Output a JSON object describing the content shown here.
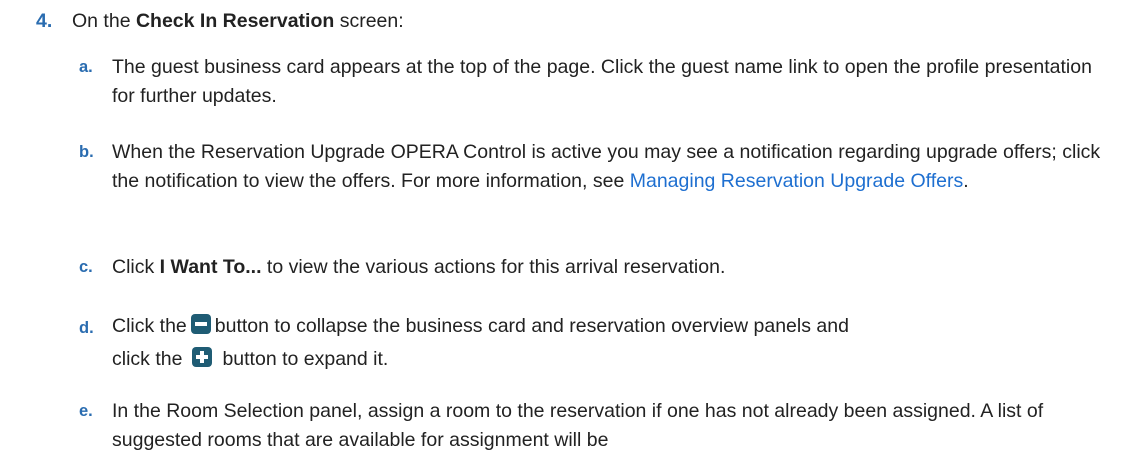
{
  "step": {
    "number": "4.",
    "text_before": "On the ",
    "bold": "Check In Reservation",
    "text_after": " screen:"
  },
  "substeps": {
    "a": {
      "letter": "a.",
      "text": "The guest business card appears at the top of the page. Click the guest name link to open the profile presentation for further updates."
    },
    "b": {
      "letter": "b.",
      "text": "When the Reservation Upgrade OPERA Control is active you may see a notification regarding upgrade offers; click the notification to view the offers. For more information, see ",
      "link": "Managing Reservation Upgrade Offers",
      "text_after": "."
    },
    "c": {
      "letter": "c.",
      "text_before": "Click ",
      "bold": "I Want To...",
      "text_after": " to view the various actions for this arrival reservation."
    },
    "d": {
      "letter": "d.",
      "text_1": "Click the",
      "text_2": "button to collapse the business card and reservation overview panels and",
      "text_3": "click the",
      "text_4": "button to expand it."
    },
    "e": {
      "letter": "e.",
      "text": "In the Room Selection panel, assign a room to the reservation if one has not already been assigned. A list of suggested rooms that are available for assignment will be"
    }
  },
  "icons": {
    "collapse": "minus-square-icon",
    "expand": "plus-square-icon"
  },
  "colors": {
    "numbering": "#2a6cb0",
    "link": "#1e6fd0",
    "icon_fill": "#1f5c74"
  }
}
